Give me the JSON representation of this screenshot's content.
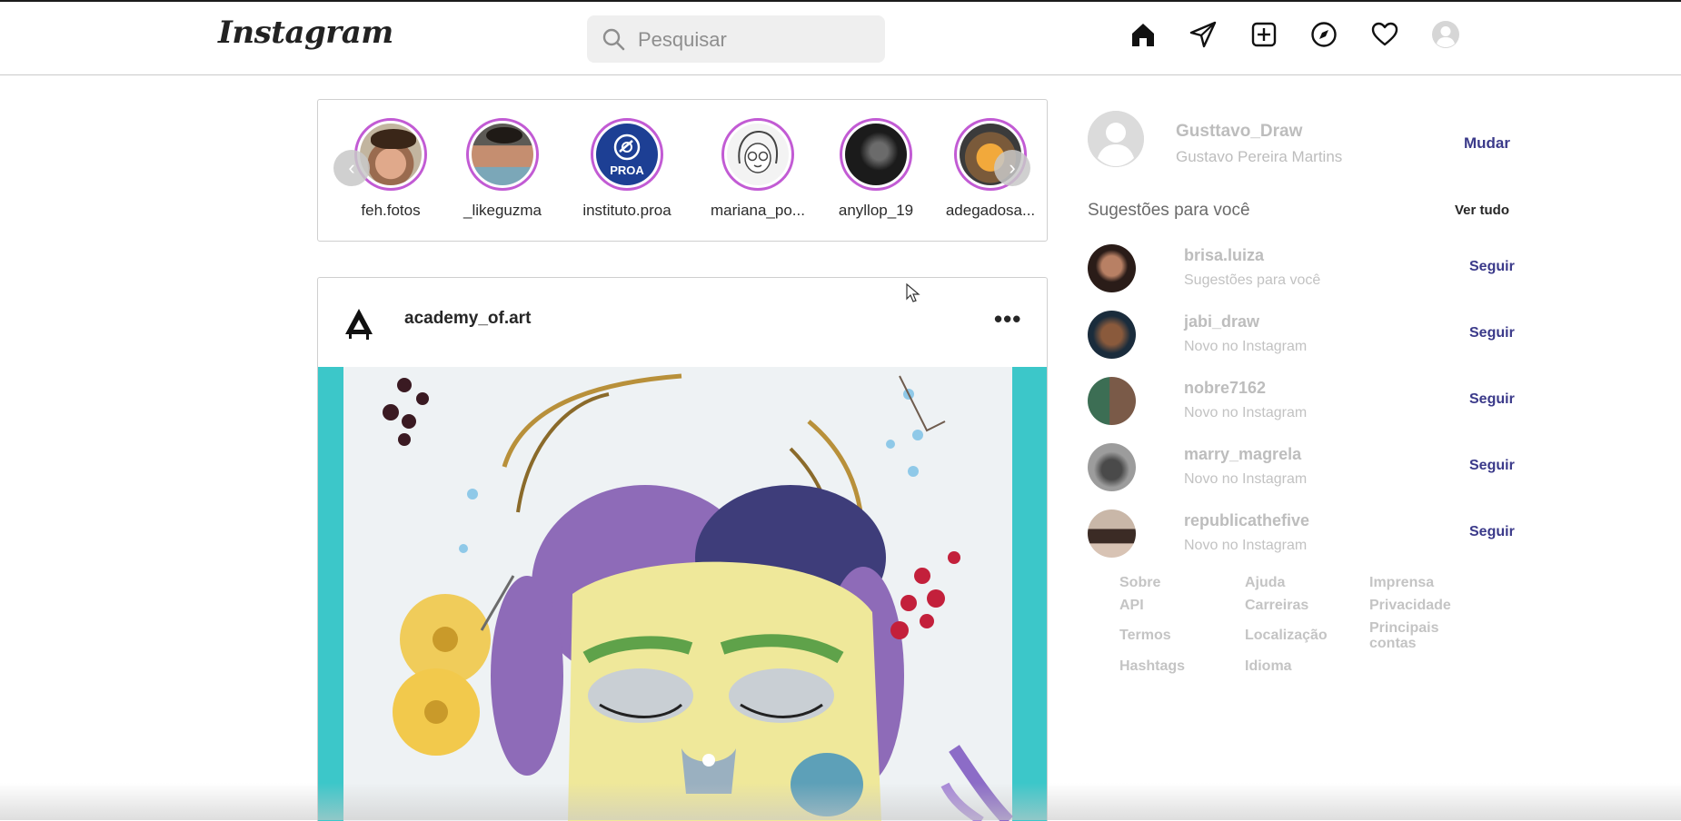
{
  "app": {
    "logo_text": "Instagram"
  },
  "search": {
    "placeholder": "Pesquisar"
  },
  "nav": [
    "home-icon",
    "direct-icon",
    "new-post-icon",
    "explore-icon",
    "activity-icon",
    "profile-icon"
  ],
  "stories": [
    {
      "username": "feh.fotos"
    },
    {
      "username": "_likeguzma"
    },
    {
      "username": "instituto.proa",
      "badge": "PROA"
    },
    {
      "username": "mariana_po..."
    },
    {
      "username": "anyllop_19"
    },
    {
      "username": "adegadosa..."
    }
  ],
  "post": {
    "username": "academy_of.art",
    "more": "•••"
  },
  "me": {
    "username": "Gusttavo_Draw",
    "full_name": "Gustavo Pereira Martins",
    "switch_label": "Mudar"
  },
  "suggestions": {
    "title": "Sugestões para você",
    "see_all": "Ver tudo",
    "follow_label": "Seguir",
    "items": [
      {
        "username": "brisa.luiza",
        "subtitle": "Sugestões para você"
      },
      {
        "username": "jabi_draw",
        "subtitle": "Novo no Instagram"
      },
      {
        "username": "nobre7162",
        "subtitle": "Novo no Instagram"
      },
      {
        "username": "marry_magrela",
        "subtitle": "Novo no Instagram"
      },
      {
        "username": "republicathefive",
        "subtitle": "Novo no Instagram"
      }
    ]
  },
  "footer": {
    "sobre": "Sobre",
    "ajuda": "Ajuda",
    "imprensa": "Imprensa",
    "api": "API",
    "carreiras": "Carreiras",
    "privacidade": "Privacidade",
    "termos": "Termos",
    "localizacao": "Localização",
    "principais_contas": "Principais contas",
    "hashtags": "Hashtags",
    "idioma": "Idioma"
  },
  "colors": {
    "accent": "#3b3a8a",
    "story_ring": "#c25bd4",
    "art_bg": "#3cc7c9"
  }
}
